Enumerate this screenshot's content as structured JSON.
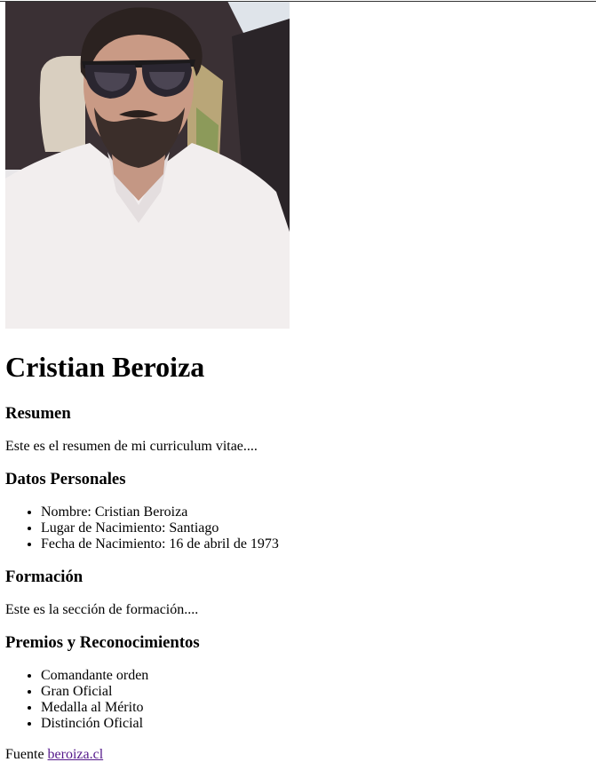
{
  "profile": {
    "photo_alt": "Cristian Beroiza",
    "name": "Cristian Beroiza"
  },
  "resumen": {
    "heading": "Resumen",
    "text": "Este es el resumen de mi curriculum vitae...."
  },
  "datos": {
    "heading": "Datos Personales",
    "items": [
      "Nombre: Cristian Beroiza",
      "Lugar de Nacimiento: Santiago",
      "Fecha de Nacimiento: 16 de abril de 1973"
    ]
  },
  "formacion": {
    "heading": "Formación",
    "text": "Este es la sección de formación...."
  },
  "premios": {
    "heading": "Premios y Reconocimientos",
    "items": [
      "Comandante orden",
      "Gran Oficial",
      "Medalla al Mérito",
      "Distinción Oficial"
    ]
  },
  "footer": {
    "prefix": "Fuente",
    "link_text": "beroiza.cl"
  },
  "colors": {
    "link": "#551a8b",
    "text": "#000000"
  }
}
